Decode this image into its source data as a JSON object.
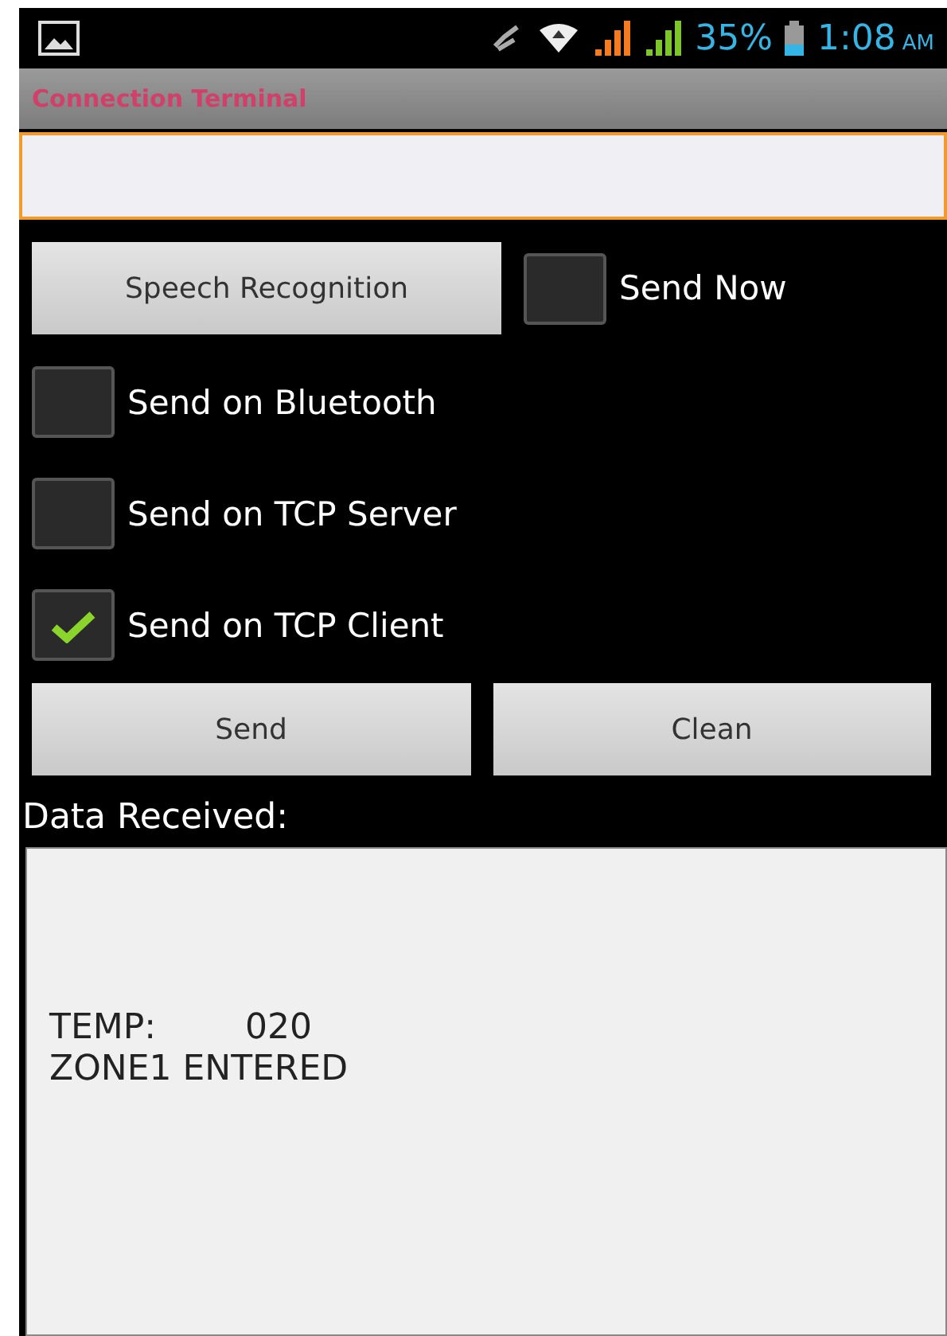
{
  "status_bar": {
    "battery_text": "35%",
    "time": "1:08",
    "meridiem": "AM"
  },
  "title_bar": {
    "title": "Connection Terminal"
  },
  "message_field": {
    "focused": true
  },
  "speech_button": {
    "label": "Speech Recognition"
  },
  "send_now": {
    "label": "Send Now",
    "checked": false
  },
  "options": [
    {
      "label": "Send on Bluetooth",
      "checked": false
    },
    {
      "label": "Send on TCP Server",
      "checked": false
    },
    {
      "label": "Send on TCP Client",
      "checked": true
    }
  ],
  "buttons": [
    {
      "label": "Send"
    },
    {
      "label": "Clean"
    }
  ],
  "received": {
    "label": "Data Received:",
    "lines": [
      "TEMP:        020",
      "ZONE1 ENTERED"
    ]
  }
}
